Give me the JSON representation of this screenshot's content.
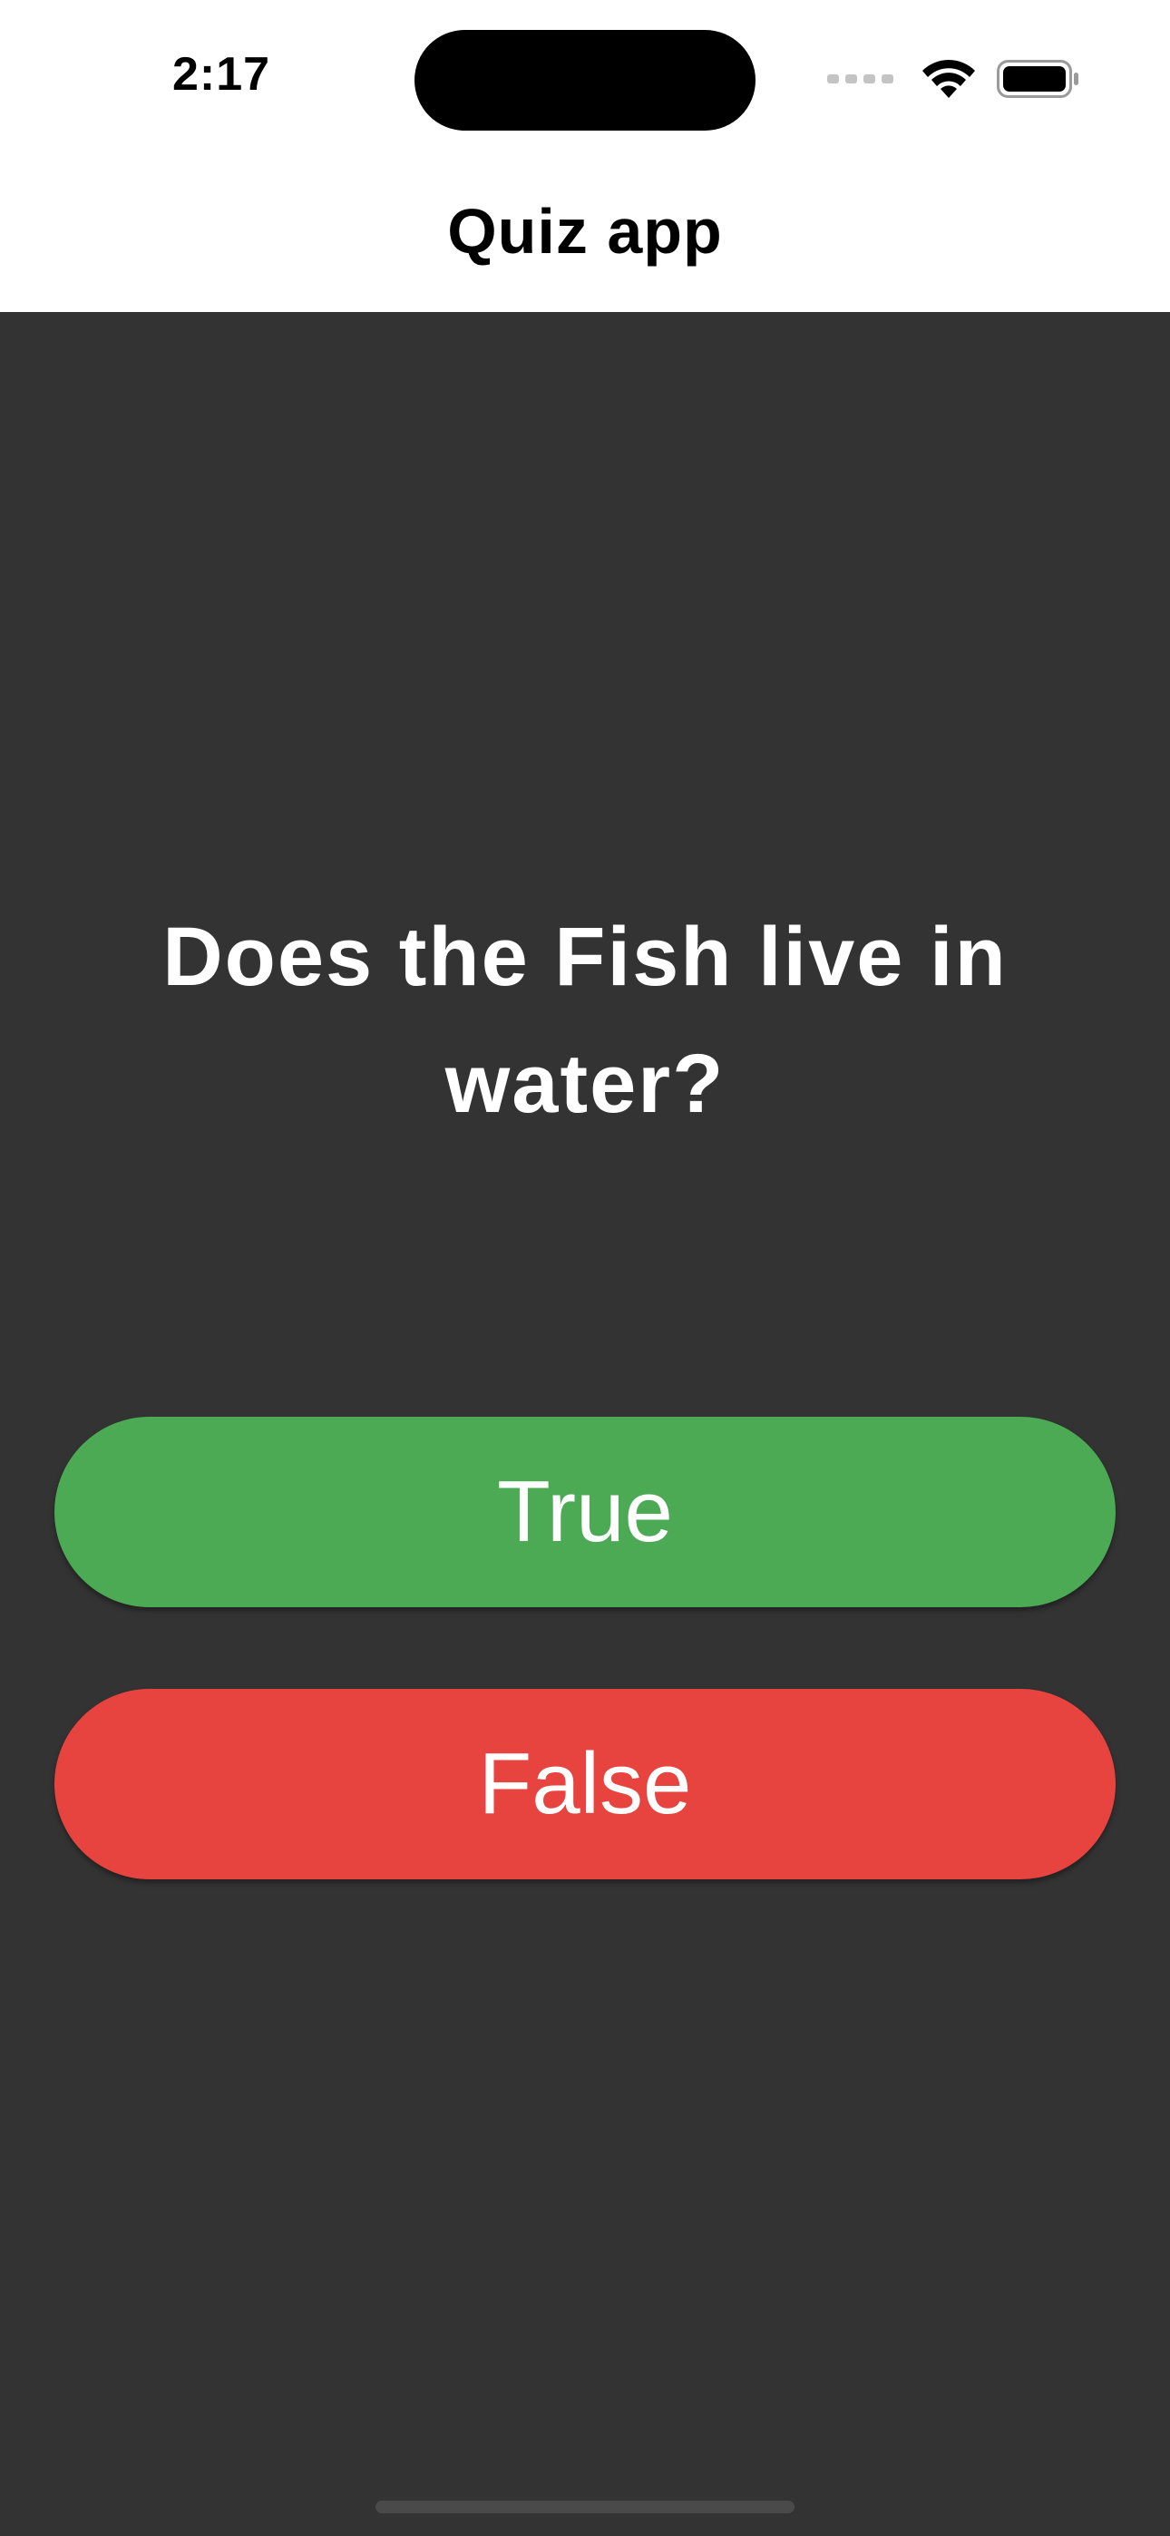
{
  "status_bar": {
    "time": "2:17",
    "icons": [
      "cellular-signal-icon",
      "wifi-icon",
      "battery-icon"
    ]
  },
  "nav": {
    "title": "Quiz app"
  },
  "quiz": {
    "question": "Does the Fish live in water?",
    "true_label": "True",
    "false_label": "False"
  },
  "colors": {
    "background": "#333333",
    "header_background": "#ffffff",
    "true_button": "#4caa54",
    "false_button": "#e7433f",
    "text_on_dark": "#ffffff"
  }
}
